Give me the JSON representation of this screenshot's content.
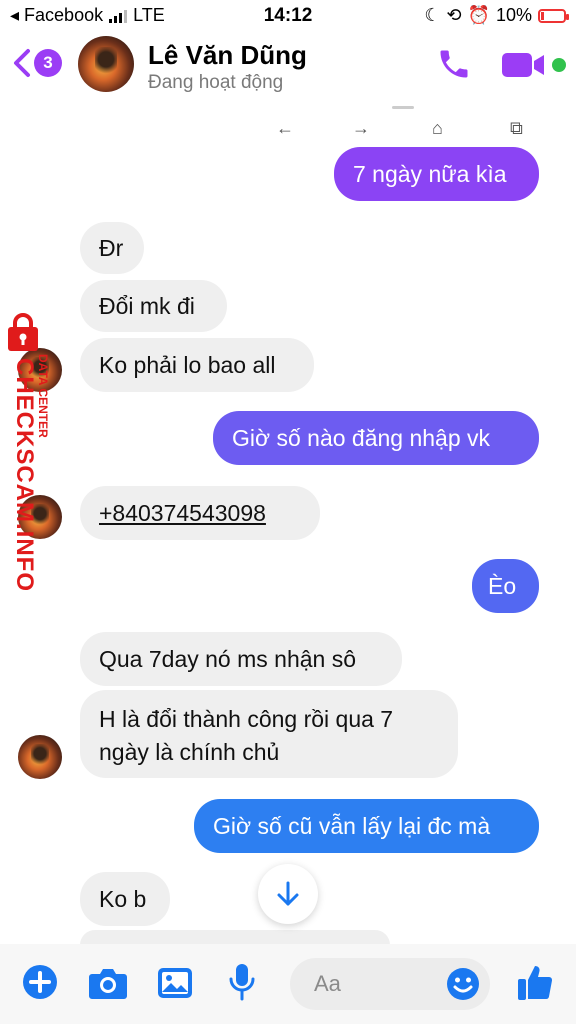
{
  "status_bar": {
    "carrier": "◂ Facebook",
    "network": "LTE",
    "time": "14:12",
    "battery": "10%"
  },
  "header": {
    "back_badge": "3",
    "name": "Lê Văn Dũng",
    "status": "Đang hoạt động"
  },
  "messages": [
    {
      "text": "7 ngày nữa kìa",
      "side": "out"
    },
    {
      "text": "Đr",
      "side": "in"
    },
    {
      "text": "Đổi mk đi",
      "side": "in"
    },
    {
      "text": "Ko phải lo bao all",
      "side": "in"
    },
    {
      "text": "Giờ số nào đăng nhập vk",
      "side": "out"
    },
    {
      "text": "+840374543098",
      "side": "in"
    },
    {
      "text": "Èo",
      "side": "out"
    },
    {
      "text": "Qua 7day nó ms nhận sô",
      "side": "in"
    },
    {
      "text": "H là đổi thành công rồi qua 7 ngày là chính chủ",
      "side": "in"
    },
    {
      "text": "Giờ số cũ vẫn lấy lại đc mà",
      "side": "out"
    },
    {
      "text": "Ko b",
      "side": "in"
    }
  ],
  "watermark": {
    "main": "CHECKSCAM.INFO",
    "sub": "DATA CENTER"
  },
  "composer": {
    "placeholder": "Aa"
  },
  "colors": {
    "accent": "#9b3df5",
    "out_purple": "#8b44f4",
    "out_blue": "#2d7ff1",
    "incoming_bg": "#efefef",
    "online": "#31c24d",
    "blue_icon": "#1a78f0"
  }
}
